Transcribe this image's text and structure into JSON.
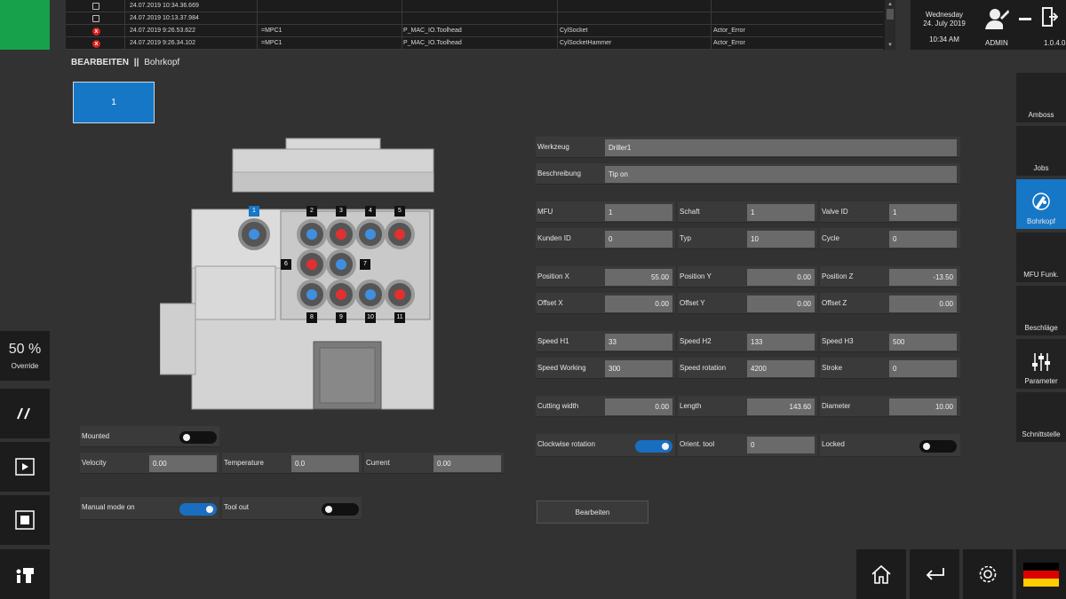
{
  "log": {
    "rows": [
      {
        "type": "info",
        "time": "24.07.2019 10:34.36.669",
        "source": "",
        "module": "",
        "object": "",
        "error": ""
      },
      {
        "type": "info",
        "time": "24.07.2019 10:13.37.984",
        "source": "",
        "module": "",
        "object": "",
        "error": ""
      },
      {
        "type": "error",
        "time": "24.07.2019 9:26.53.622",
        "source": "=MPC1",
        "module": "P_MAC_IO.Toolhead",
        "object": "CylSocket",
        "error": "Actor_Error"
      },
      {
        "type": "error",
        "time": "24.07.2019 9:26.34.102",
        "source": "=MPC1",
        "module": "P_MAC_IO.Toolhead",
        "object": "CylSocketHammer",
        "error": "Actor_Error"
      }
    ],
    "error_glyph": "x"
  },
  "header": {
    "weekday": "Wednesday",
    "date": "24. July 2019",
    "time": "10:34 AM",
    "user": "ADMIN",
    "version": "1.0.4.0"
  },
  "breadcrumb": {
    "section": "BEARBEITEN",
    "separator": "||",
    "page": "Bohrkopf"
  },
  "tab_button": "1",
  "left_panel": {
    "override_value": "50 %",
    "override_label": "Override"
  },
  "right_nav": [
    {
      "label": "Amboss",
      "icon": "none",
      "active": false
    },
    {
      "label": "Jobs",
      "icon": "none",
      "active": false
    },
    {
      "label": "Bohrkopf",
      "icon": "drill-icon",
      "active": true
    },
    {
      "label": "MFU Funk.",
      "icon": "none",
      "active": false
    },
    {
      "label": "Beschläge",
      "icon": "none",
      "active": false
    },
    {
      "label": "Parameter",
      "icon": "sliders-icon",
      "active": false
    },
    {
      "label": "Schnittstelle",
      "icon": "none",
      "active": false
    }
  ],
  "drillhead": {
    "spindle_numbers": [
      "1",
      "2",
      "3",
      "4",
      "5",
      "6",
      "7",
      "8",
      "9",
      "10",
      "11"
    ]
  },
  "tool_status": {
    "mounted_label": "Mounted",
    "mounted": false,
    "velocity_label": "Velocity",
    "velocity": "0.00",
    "temperature_label": "Temperature",
    "temperature": "0.0",
    "current_label": "Current",
    "current": "0.00",
    "manual_mode_label": "Manual mode on",
    "manual_mode": true,
    "tool_out_label": "Tool out",
    "tool_out": false
  },
  "form": {
    "werkzeug_label": "Werkzeug",
    "werkzeug": "Driller1",
    "beschreibung_label": "Beschreibung",
    "beschreibung": "Tip on",
    "mfu_label": "MFU",
    "mfu": "1",
    "schaft_label": "Schaft",
    "schaft": "1",
    "valve_label": "Valve ID",
    "valve": "1",
    "kunden_label": "Kunden ID",
    "kunden": "0",
    "typ_label": "Typ",
    "typ": "10",
    "cycle_label": "Cycle",
    "cycle": "0",
    "posx_label": "Position X",
    "posx": "55.00",
    "posy_label": "Position Y",
    "posy": "0.00",
    "posz_label": "Position Z",
    "posz": "-13.50",
    "offx_label": "Offset X",
    "offx": "0.00",
    "offy_label": "Offset Y",
    "offy": "0.00",
    "offz_label": "Offset Z",
    "offz": "0.00",
    "sh1_label": "Speed H1",
    "sh1": "33",
    "sh2_label": "Speed H2",
    "sh2": "133",
    "sh3_label": "Speed H3",
    "sh3": "500",
    "swork_label": "Speed Working",
    "swork": "300",
    "srot_label": "Speed rotation",
    "srot": "4200",
    "stroke_label": "Stroke",
    "stroke": "0",
    "cutw_label": "Cutting width",
    "cutw": "0.00",
    "length_label": "Length",
    "length": "143.60",
    "diam_label": "Diameter",
    "diam": "10.00",
    "cw_label": "Clockwise rotation",
    "cw": true,
    "orient_label": "Orient. tool",
    "orient": "0",
    "locked_label": "Locked",
    "locked": false,
    "edit_button": "Bearbeiten"
  },
  "colors": {
    "accent": "#1677c7",
    "ok": "#17a14a",
    "error": "#d92020"
  }
}
